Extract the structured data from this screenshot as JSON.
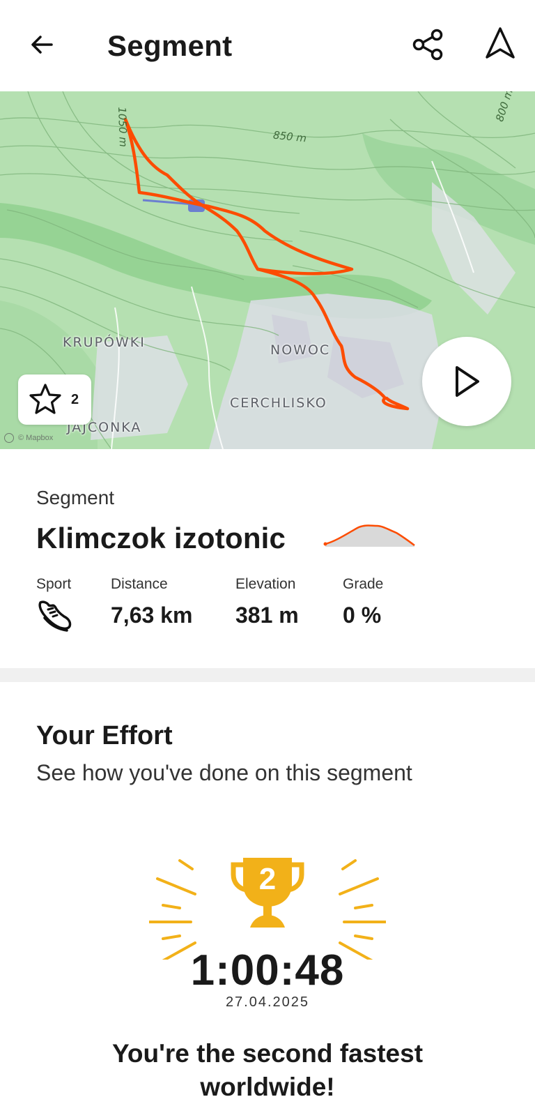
{
  "header": {
    "title": "Segment",
    "back_icon": "arrow-left-icon",
    "share_icon": "share-icon",
    "navigate_icon": "navigation-arrow-icon"
  },
  "map": {
    "labels": {
      "krupowki": "KRUPÓWKI",
      "nowoc": "NOWOC",
      "cerchlisko": "CERCHLISKO",
      "jajconka": "JAJCONKA"
    },
    "contours": {
      "c1050": "1050 m",
      "c850": "850 m",
      "c800": "800 m"
    },
    "attribution": "© Mapbox",
    "star_count": "2",
    "route_color": "#fc4c02",
    "play_icon": "play-icon"
  },
  "segment": {
    "kicker": "Segment",
    "name": "Klimczok izotonic",
    "stats": {
      "sport_label": "Sport",
      "sport_icon": "running-shoe-icon",
      "distance_label": "Distance",
      "distance_value": "7,63 km",
      "elevation_label": "Elevation",
      "elevation_value": "381 m",
      "grade_label": "Grade",
      "grade_value": "0 %"
    }
  },
  "effort": {
    "title": "Your Effort",
    "subtitle": "See how you've done on this segment",
    "rank": "2",
    "time": "1:00:48",
    "date": "27.04.2025",
    "message": "You're the second fastest worldwide!",
    "trophy_color": "#f2b119"
  }
}
